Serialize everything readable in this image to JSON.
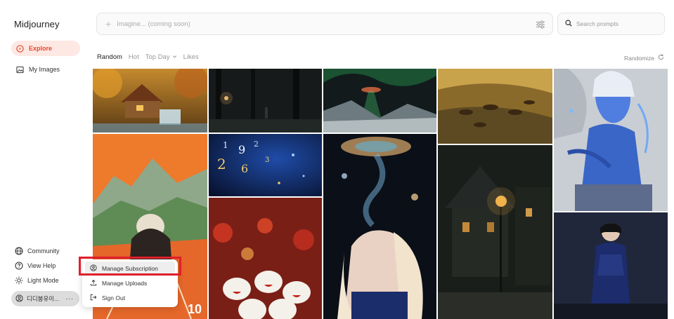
{
  "app": {
    "name": "Midjourney"
  },
  "sidebar": {
    "nav": [
      {
        "label": "Explore",
        "icon": "compass-icon",
        "active": true
      },
      {
        "label": "My Images",
        "icon": "image-icon",
        "active": false
      }
    ],
    "bottom": [
      {
        "label": "Community",
        "icon": "globe-icon"
      },
      {
        "label": "View Help",
        "icon": "help-icon"
      },
      {
        "label": "Light Mode",
        "icon": "sun-icon"
      }
    ],
    "user": {
      "name": "디디붐유이...",
      "more": "···"
    }
  },
  "topbar": {
    "imagine_placeholder": "Imagine... (coming soon)",
    "search_placeholder": "Search prompts"
  },
  "tabs": [
    {
      "label": "Random",
      "active": true
    },
    {
      "label": "Hot",
      "active": false
    },
    {
      "label": "Top Day",
      "active": false,
      "dropdown": true
    },
    {
      "label": "Likes",
      "active": false
    }
  ],
  "randomize_label": "Randomize",
  "user_menu": [
    {
      "label": "Manage Subscription",
      "icon": "account-icon",
      "highlighted": true
    },
    {
      "label": "Manage Uploads",
      "icon": "upload-icon",
      "highlighted": false
    },
    {
      "label": "Sign Out",
      "icon": "sign-out-icon",
      "highlighted": false
    }
  ],
  "gallery": [
    {
      "name": "cabin-waterfall-autumn"
    },
    {
      "name": "dark-forest-night"
    },
    {
      "name": "ufo-aurora-night"
    },
    {
      "name": "horses-golden-field"
    },
    {
      "name": "blue-ice-elf-painting"
    },
    {
      "name": "athlete-mountains-illustration"
    },
    {
      "name": "floating-numbers-space"
    },
    {
      "name": "girl-smoke-bubbles"
    },
    {
      "name": "dark-village-lanterns"
    },
    {
      "name": "rice-cakes-lanterns"
    },
    {
      "name": "model-blue-qipao"
    }
  ],
  "colors": {
    "accent": "#e2492f",
    "active_bg": "#fde8e4",
    "highlight_border": "#e01f2b"
  }
}
